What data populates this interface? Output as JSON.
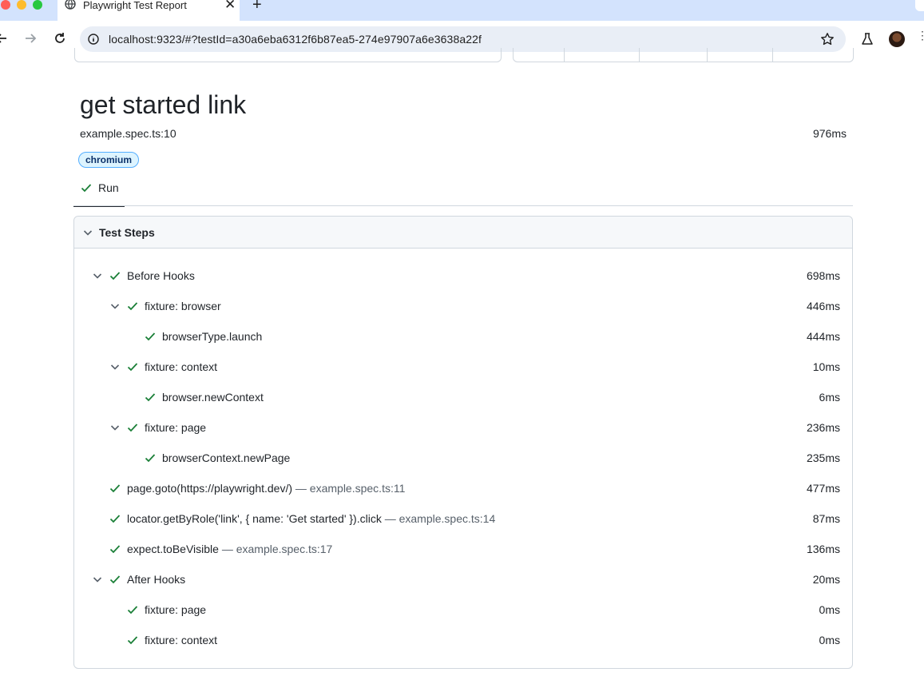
{
  "browser": {
    "tab_title": "Playwright Test Report",
    "url": "localhost:9323/#?testId=a30a6eba6312f6b87ea5-274e97907a6e3638a22f"
  },
  "test": {
    "title": "get started link",
    "location": "example.spec.ts:10",
    "duration": "976ms",
    "project_tag": "chromium",
    "run_tab": "Run"
  },
  "steps_header": "Test Steps",
  "steps": [
    {
      "label": "Before Hooks",
      "loc": "",
      "duration": "698ms"
    },
    {
      "label": "fixture: browser",
      "loc": "",
      "duration": "446ms"
    },
    {
      "label": "browserType.launch",
      "loc": "",
      "duration": "444ms"
    },
    {
      "label": "fixture: context",
      "loc": "",
      "duration": "10ms"
    },
    {
      "label": "browser.newContext",
      "loc": "",
      "duration": "6ms"
    },
    {
      "label": "fixture: page",
      "loc": "",
      "duration": "236ms"
    },
    {
      "label": "browserContext.newPage",
      "loc": "",
      "duration": "235ms"
    },
    {
      "label": "page.goto(https://playwright.dev/)",
      "loc": "— example.spec.ts:11",
      "duration": "477ms"
    },
    {
      "label": "locator.getByRole('link', { name: 'Get started' }).click",
      "loc": "— example.spec.ts:14",
      "duration": "87ms"
    },
    {
      "label": "expect.toBeVisible",
      "loc": "— example.spec.ts:17",
      "duration": "136ms"
    },
    {
      "label": "After Hooks",
      "loc": "",
      "duration": "20ms"
    },
    {
      "label": "fixture: page",
      "loc": "",
      "duration": "0ms"
    },
    {
      "label": "fixture: context",
      "loc": "",
      "duration": "0ms"
    }
  ],
  "colors": {
    "pass_green": "#1a7f37",
    "tag_blue": "#0a3069"
  }
}
